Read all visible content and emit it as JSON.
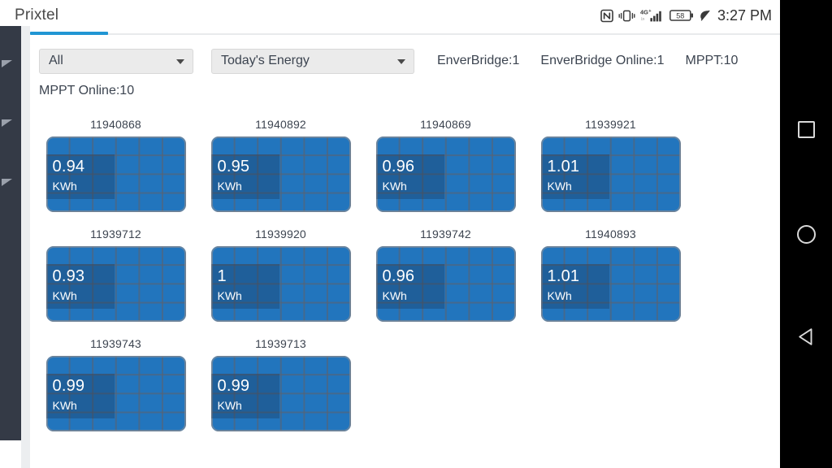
{
  "statusbar": {
    "app_title": "Prixtel",
    "clock": "3:27 PM",
    "battery_level": "58",
    "network_label": "4G+",
    "icons": [
      "nfc-icon",
      "vibrate-icon",
      "signal-icon",
      "battery-icon",
      "power-saving-leaf-icon"
    ]
  },
  "filters": {
    "device_select": {
      "value": "All",
      "placeholder": "All"
    },
    "metric_select": {
      "value": "Today's Energy",
      "placeholder": "Today's Energy"
    }
  },
  "stats": {
    "enverbridge": "EnverBridge:1",
    "enverbridge_online": "EnverBridge Online:1",
    "mppt": "MPPT:10",
    "mppt_online": "MPPT Online:10"
  },
  "panels": [
    [
      {
        "id": "11940868",
        "value": "0.94",
        "unit": "KWh"
      },
      {
        "id": "11940892",
        "value": "0.95",
        "unit": "KWh"
      },
      {
        "id": "11940869",
        "value": "0.96",
        "unit": "KWh"
      },
      {
        "id": "11939921",
        "value": "1.01",
        "unit": "KWh"
      }
    ],
    [
      {
        "id": "11939712",
        "value": "0.93",
        "unit": "KWh"
      },
      {
        "id": "11939920",
        "value": "1",
        "unit": "KWh"
      },
      {
        "id": "11939742",
        "value": "0.96",
        "unit": "KWh"
      },
      {
        "id": "11940893",
        "value": "1.01",
        "unit": "KWh"
      }
    ],
    [
      {
        "id": "11939743",
        "value": "0.99",
        "unit": "KWh"
      },
      {
        "id": "11939713",
        "value": "0.99",
        "unit": "KWh"
      }
    ]
  ],
  "navbar": {
    "recents_label": "recents",
    "home_label": "home",
    "back_label": "back"
  },
  "colors": {
    "accent": "#2196d3",
    "panel_blue": "#2275bd",
    "rail_dark": "#343a46",
    "text": "#3c4450"
  }
}
